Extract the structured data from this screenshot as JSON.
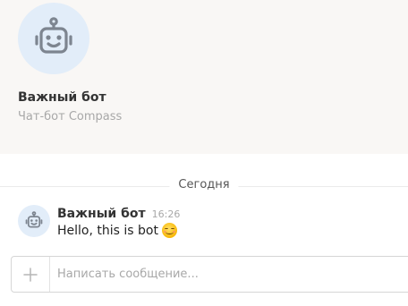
{
  "profile": {
    "name": "Важный бот",
    "subtitle": "Чат-бот Compass",
    "avatar_icon": "robot-icon",
    "avatar_bg": "#e2edf9"
  },
  "date_divider": {
    "label": "Сегодня"
  },
  "messages": [
    {
      "author": "Важный бот",
      "time": "16:26",
      "text": "Hello, this is bot",
      "emoji_icon": "smiling-face-icon",
      "avatar_icon": "robot-icon"
    }
  ],
  "composer": {
    "placeholder": "Написать сообщение...",
    "value": "",
    "attach_icon": "plus-icon"
  },
  "colors": {
    "header_bg": "#f9f7f5",
    "avatar_bg": "#e2edf9",
    "robot_stroke": "#7d8590",
    "muted_text": "#a8a8a8"
  }
}
